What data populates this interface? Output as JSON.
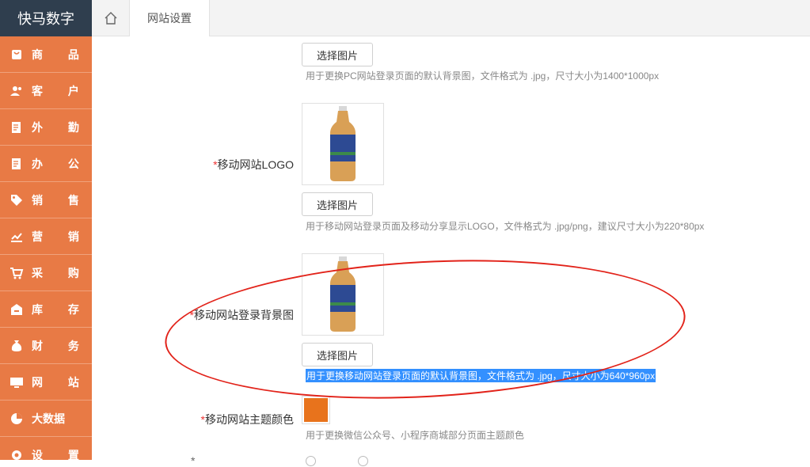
{
  "sidebar": {
    "brand": "快马数字",
    "items": [
      {
        "label": "商 品",
        "icon": "bag-icon"
      },
      {
        "label": "客 户",
        "icon": "users-icon"
      },
      {
        "label": "外 勤",
        "icon": "checklist-icon"
      },
      {
        "label": "办 公",
        "icon": "document-icon"
      },
      {
        "label": "销 售",
        "icon": "tag-icon"
      },
      {
        "label": "营 销",
        "icon": "chart-icon"
      },
      {
        "label": "采 购",
        "icon": "cart-icon"
      },
      {
        "label": "库 存",
        "icon": "warehouse-icon"
      },
      {
        "label": "财 务",
        "icon": "money-bag-icon"
      },
      {
        "label": "网 站",
        "icon": "monitor-icon"
      },
      {
        "label": "大数据",
        "icon": "pie-icon"
      },
      {
        "label": "设 置",
        "icon": "gear-icon"
      }
    ]
  },
  "topbar": {
    "home_icon": "home-icon",
    "tab_label": "网站设置"
  },
  "form": {
    "pc_bg": {
      "button": "选择图片",
      "hint": "用于更换PC网站登录页面的默认背景图，文件格式为 .jpg，尺寸大小为1400*1000px"
    },
    "mobile_logo": {
      "required": "*",
      "label": "移动网站LOGO",
      "button": "选择图片",
      "hint": "用于移动网站登录页面及移动分享显示LOGO，文件格式为 .jpg/png，建议尺寸大小为220*80px"
    },
    "mobile_bg": {
      "required": "*",
      "label": "移动网站登录背景图",
      "button": "选择图片",
      "hint": "用于更换移动网站登录页面的默认背景图，文件格式为 .jpg，尺寸大小为640*960px"
    },
    "theme_color": {
      "required": "*",
      "label": "移动网站主题颜色",
      "value": "#e8731c",
      "hint": "用于更换微信公众号、小程序商城部分页面主题颜色"
    }
  },
  "colors": {
    "sidebar": "#e87a45",
    "brand_bg": "#2f3e4e",
    "highlight_circle": "#e2231a",
    "selection": "#3390ff"
  }
}
